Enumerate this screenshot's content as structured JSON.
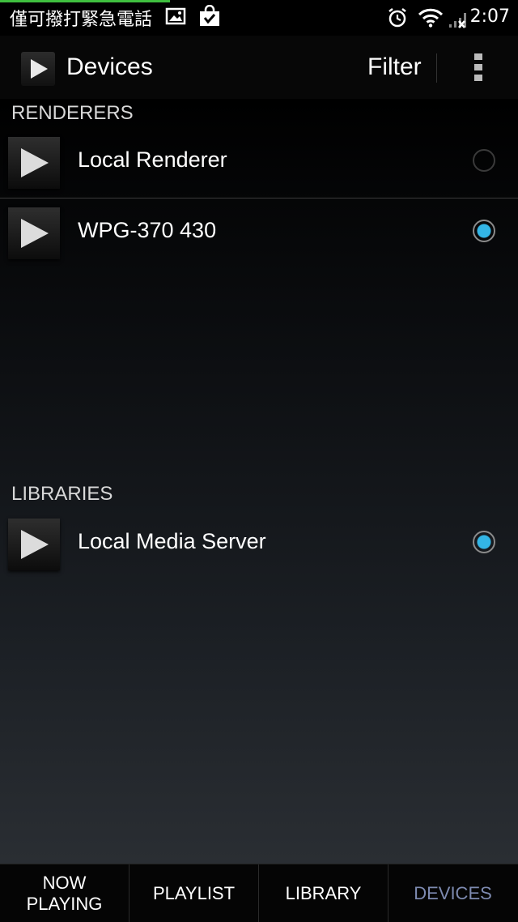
{
  "status_bar": {
    "carrier_text": "僅可撥打緊急電話",
    "time": "2:07",
    "icons": [
      "image-notification-icon",
      "shopping-bag-check-icon",
      "alarm-icon",
      "wifi-icon",
      "signal-no-service-icon"
    ]
  },
  "action_bar": {
    "title": "Devices",
    "filter_label": "Filter",
    "overflow_icon": "more-vertical-icon"
  },
  "renderers": {
    "header": "RENDERERS",
    "items": [
      {
        "label": "Local Renderer",
        "selected": false
      },
      {
        "label": "WPG-370 430",
        "selected": true
      }
    ]
  },
  "libraries": {
    "header": "LIBRARIES",
    "items": [
      {
        "label": "Local Media Server",
        "selected": true
      }
    ]
  },
  "tabs": [
    {
      "label": "NOW\nPLAYING",
      "selected": false
    },
    {
      "label": "PLAYLIST",
      "selected": false
    },
    {
      "label": "LIBRARY",
      "selected": false
    },
    {
      "label": "DEVICES",
      "selected": true
    }
  ],
  "colors": {
    "accent": "#33b5e5",
    "selected_tab": "#7d8ab0"
  }
}
